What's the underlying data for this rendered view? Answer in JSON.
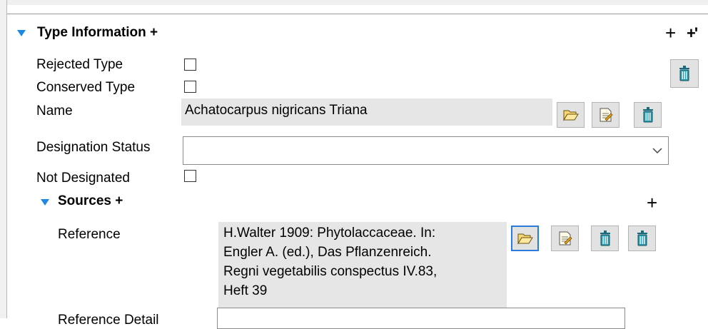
{
  "type_info": {
    "title": "Type Information",
    "add_symbol": "+",
    "header_plus": "+",
    "header_plus2": "+'"
  },
  "fields": {
    "rejected_type_label": "Rejected Type",
    "conserved_type_label": "Conserved Type",
    "name_label": "Name",
    "name_value": "Achatocarpus nigricans Triana",
    "designation_status_label": "Designation Status",
    "designation_status_value": "",
    "not_designated_label": "Not Designated"
  },
  "sources": {
    "title": "Sources",
    "add_symbol": "+",
    "header_plus": "+",
    "reference_label": "Reference",
    "reference_lines": [
      "H.Walter 1909: Phytolaccaceae. In:",
      "Engler A. (ed.), Das Pflanzenreich.",
      "Regni vegetabilis conspectus IV.83,",
      "Heft 39"
    ],
    "reference_detail_label": "Reference Detail"
  },
  "colors": {
    "accent": "#1e88e5",
    "field_bg": "#e6e6e6",
    "button_bg": "#e2e2e2"
  }
}
